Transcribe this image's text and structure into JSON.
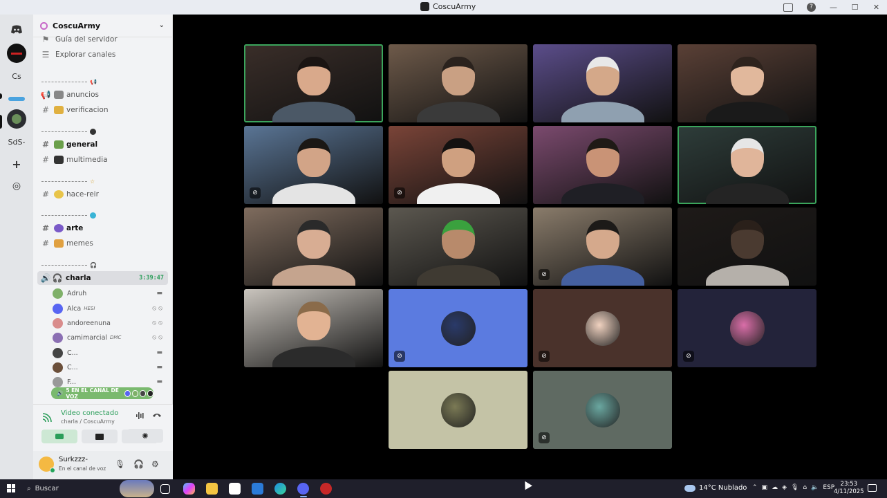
{
  "window": {
    "title": "CoscuArmy",
    "controls": [
      "—",
      "☐",
      "✕"
    ]
  },
  "rail": {
    "items": [
      {
        "name": "discord-home",
        "label": ""
      },
      {
        "name": "server-red",
        "label": ""
      },
      {
        "name": "server-cs",
        "label": "Cs"
      },
      {
        "name": "server-blue",
        "label": ""
      },
      {
        "name": "server-coscuarmy",
        "label": ""
      },
      {
        "name": "server-sds",
        "label": "SdS-"
      },
      {
        "name": "add-server",
        "label": "+"
      },
      {
        "name": "explore",
        "label": "◎"
      }
    ]
  },
  "server": {
    "name": "CoscuArmy"
  },
  "channels": {
    "guia": "Guía del servidor",
    "explorar": "Explorar canales",
    "anuncios": "anuncios",
    "verificacion": "verificacion",
    "general": "general",
    "multimedia": "multimedia",
    "hace_reir": "hace-reir",
    "arte": "arte",
    "memes": "memes",
    "charla": "charla",
    "charla_timer": "3:39:47"
  },
  "voice_users": [
    {
      "name": "Adruh",
      "tag": "",
      "color": "#7fb069"
    },
    {
      "name": "Alca",
      "tag": "HESI",
      "color": "#5865f2"
    },
    {
      "name": "andoreenuna",
      "tag": "",
      "color": "#d98c8c"
    },
    {
      "name": "camimarcial",
      "tag": "DMC",
      "color": "#8b6fb3"
    },
    {
      "name": "C...",
      "tag": "",
      "color": "#444"
    },
    {
      "name": "C...",
      "tag": "",
      "color": "#6b4f3a"
    },
    {
      "name": "F...",
      "tag": "",
      "color": "#999"
    }
  ],
  "voice_banner": "5 EN EL CANAL DE VOZ",
  "voice_panel": {
    "status": "Video conectado",
    "location": "charla / CoscuArmy"
  },
  "user": {
    "name": "Surkzzz-",
    "status": "En el canal de voz"
  },
  "tiles": [
    {
      "bg": "#3a2e29",
      "head": "#d9a98b",
      "hair": "#1a1412",
      "shirt": "#4b5866",
      "speaking": true,
      "mic_off": false
    },
    {
      "bg": "#6e5a4a",
      "head": "#c9a083",
      "hair": "#2a221d",
      "shirt": "#3a3a3a",
      "speaking": false,
      "mic_off": false
    },
    {
      "bg": "#5b4d8a",
      "head": "#d4a889",
      "hair": "#e8e8e8",
      "shirt": "#8fa0b0",
      "speaking": false,
      "mic_off": false
    },
    {
      "bg": "#5a4036",
      "head": "#e1b89c",
      "hair": "#2e231d",
      "shirt": "#1a1a1a",
      "speaking": false,
      "mic_off": false
    },
    {
      "bg": "#5a7595",
      "head": "#d2a487",
      "hair": "#1b1815",
      "shirt": "#e4e4e4",
      "speaking": false,
      "mic_off": true
    },
    {
      "bg": "#7a4438",
      "head": "#cfa080",
      "hair": "#141110",
      "shirt": "#f0f0f0",
      "speaking": false,
      "mic_off": true
    },
    {
      "bg": "#7b4a6e",
      "head": "#c99376",
      "hair": "#1f1a16",
      "shirt": "#1f1f25",
      "speaking": false,
      "mic_off": false
    },
    {
      "bg": "#2e3d3a",
      "head": "#e0b59a",
      "hair": "#e6e6e6",
      "shirt": "#242424",
      "speaking": true,
      "mic_off": false
    },
    {
      "bg": "#7f6c5e",
      "head": "#d8ad93",
      "hair": "#2a2a2a",
      "shirt": "#c5a48e",
      "speaking": false,
      "mic_off": false
    },
    {
      "bg": "#5c5850",
      "head": "#b88a6b",
      "hair": "#3aa13e",
      "shirt": "#3f3a32",
      "speaking": false,
      "mic_off": false
    },
    {
      "bg": "#8a7c6b",
      "head": "#d5a98c",
      "hair": "#1c1a18",
      "shirt": "#4560a0",
      "speaking": false,
      "mic_off": true
    },
    {
      "bg": "#1e1a18",
      "head": "#4a3a30",
      "hair": "#2a201a",
      "shirt": "#b5b0aa",
      "speaking": false,
      "mic_off": false
    },
    {
      "bg": "#c9c4bd",
      "head": "#e2b393",
      "hair": "#8a6b4a",
      "shirt": "#2b2b2b",
      "speaking": false,
      "mic_off": false
    }
  ],
  "avatar_tiles": [
    {
      "bg": "#5b7be0",
      "avatar": "#2a3a6a",
      "mic_off": true
    },
    {
      "bg": "#4a322b",
      "avatar": "#f0d2c0",
      "mic_off": true
    },
    {
      "bg": "#23233a",
      "avatar": "#d96ea8",
      "mic_off": true
    },
    {
      "bg": "#c4c3a6",
      "avatar": "#7b7a55",
      "mic_off": false
    },
    {
      "bg": "#5f6a62",
      "avatar": "#6aa7a0",
      "mic_off": true
    }
  ],
  "taskbar": {
    "search": "Buscar",
    "weather": "14°C  Nublado",
    "lang": "ESP",
    "time": "23:53",
    "date": "4/11/2025"
  }
}
